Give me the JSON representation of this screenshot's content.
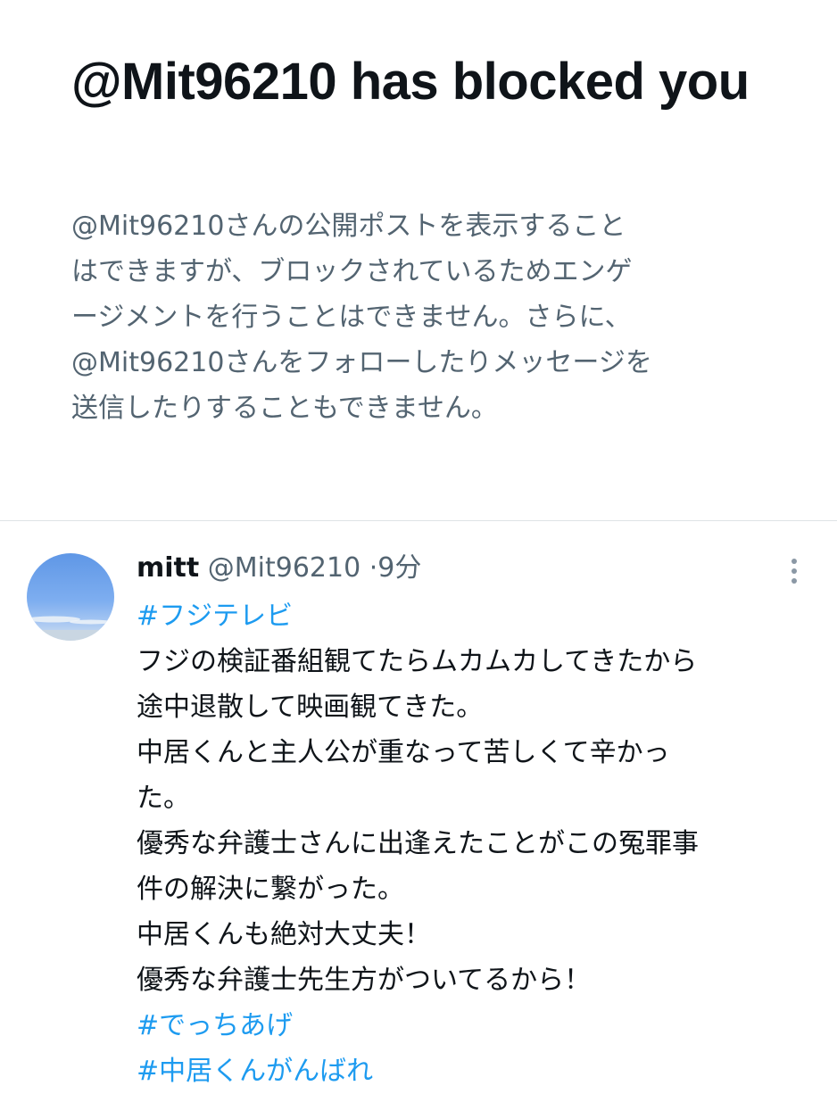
{
  "block_notice": {
    "title": "@Mit96210 has blocked you",
    "body_lines": [
      "@Mit96210さんの公開ポストを表示すること",
      "はできますが、ブロックされているためエンゲ",
      "ージメントを行うことはできません。さらに、",
      "@Mit96210さんをフォローしたりメッセージを",
      "送信したりすることもできません。"
    ]
  },
  "tweet": {
    "display_name": "mitt",
    "handle": "@Mit96210",
    "separator": "·",
    "time": "9分",
    "more_icon": "more-vertical-icon",
    "lines": [
      "#フジテレビ",
      "フジの検証番組観てたらムカムカしてきたから",
      "途中退散して映画観てきた。",
      "中居くんと主人公が重なって苦しくて辛かっ",
      "た。",
      "優秀な弁護士さんに出逢えたことがこの冤罪事",
      "件の解決に繋がった。",
      "中居くんも絶対大丈夫！",
      "優秀な弁護士先生方がついてるから！",
      "#でっちあげ",
      "#中居くんがんばれ"
    ]
  },
  "colors": {
    "text_primary": "#0f1419",
    "text_secondary": "#536471",
    "link": "#1d9bf0",
    "divider": "#dfe3e6"
  }
}
